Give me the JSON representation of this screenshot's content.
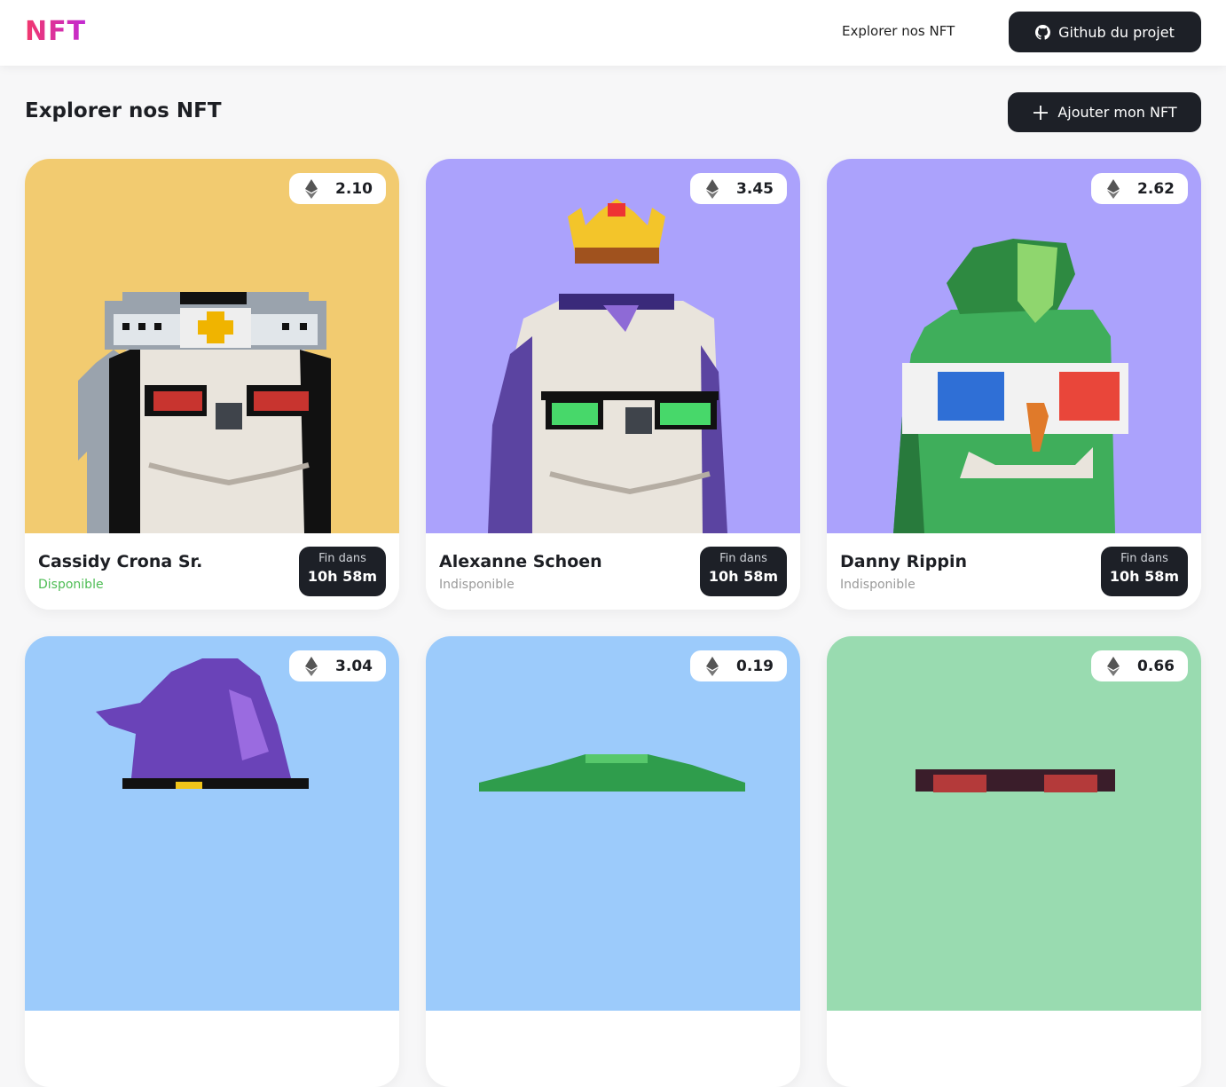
{
  "header": {
    "logo": "NFT",
    "nav_link": "Explorer nos NFT",
    "github_button": "Github du projet"
  },
  "main": {
    "title": "Explorer nos NFT",
    "add_button": "Ajouter mon NFT"
  },
  "cards": [
    {
      "price": "2.10",
      "name": "Cassidy Crona Sr.",
      "status": "Disponible",
      "timer_label": "Fin dans",
      "timer_value": "10h 58m",
      "bg": "#f2cb70"
    },
    {
      "price": "3.45",
      "name": "Alexanne Schoen",
      "status": "Indisponible",
      "timer_label": "Fin dans",
      "timer_value": "10h 58m",
      "bg": "#aba2fc"
    },
    {
      "price": "2.62",
      "name": "Danny Rippin",
      "status": "Indisponible",
      "timer_label": "Fin dans",
      "timer_value": "10h 58m",
      "bg": "#aba2fc"
    },
    {
      "price": "3.04",
      "name": "",
      "status": "",
      "timer_label": "",
      "timer_value": "",
      "bg": "#9ccbfb"
    },
    {
      "price": "0.19",
      "name": "",
      "status": "",
      "timer_label": "",
      "timer_value": "",
      "bg": "#9ccbfb"
    },
    {
      "price": "0.66",
      "name": "",
      "status": "",
      "timer_label": "",
      "timer_value": "",
      "bg": "#99dbb0"
    }
  ],
  "icons": {
    "github": "github-icon",
    "plus": "plus-icon",
    "currency": "ethereum-icon"
  },
  "colors": {
    "logo_gradient": [
      "#f2386b",
      "#c22bd4"
    ],
    "dark_button": "#1d2027",
    "available": "#4ebd55",
    "unavailable": "#9a9a9a"
  }
}
